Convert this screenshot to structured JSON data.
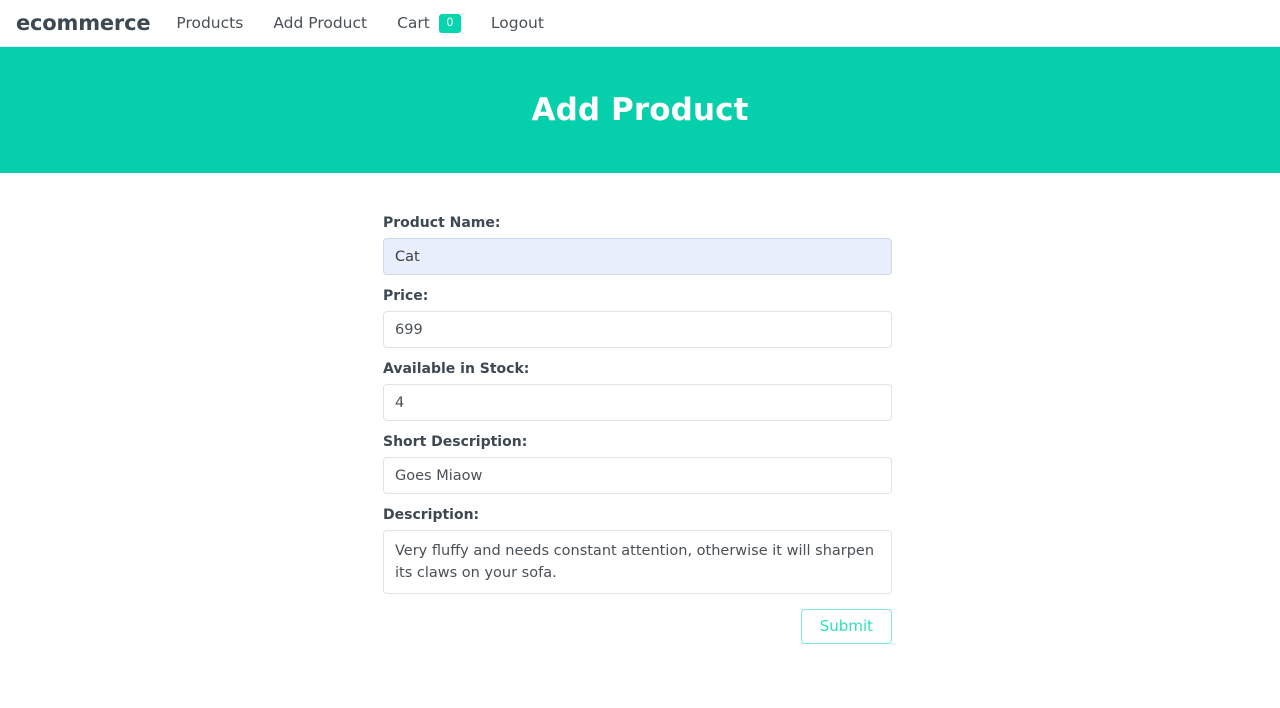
{
  "theme": {
    "accent": "#06d6ad",
    "hero_bg": "#06d0ab",
    "text_dark": "#3d4852",
    "autofill_bg": "#e8eefc",
    "submit_border": "#7ee8d6",
    "submit_text": "#2ee0bd"
  },
  "navbar": {
    "brand": "ecommerce",
    "links": [
      {
        "label": "Products",
        "name": "nav-link-products"
      },
      {
        "label": "Add Product",
        "name": "nav-link-add-product"
      },
      {
        "label": "Cart",
        "name": "nav-link-cart",
        "badge": "0"
      },
      {
        "label": "Logout",
        "name": "nav-link-logout"
      }
    ]
  },
  "hero": {
    "title": "Add Product"
  },
  "form": {
    "fields": [
      {
        "label": "Product Name:",
        "value": "Cat",
        "placeholder": "",
        "type": "text",
        "autofilled": true
      },
      {
        "label": "Price:",
        "value": "699",
        "placeholder": "",
        "type": "text",
        "autofilled": false
      },
      {
        "label": "Available in Stock:",
        "value": "4",
        "placeholder": "",
        "type": "text",
        "autofilled": false
      },
      {
        "label": "Short Description:",
        "value": "Goes Miaow",
        "placeholder": "",
        "type": "text",
        "autofilled": false
      },
      {
        "label": "Description:",
        "value": "Very fluffy and needs constant attention, otherwise it will sharpen its claws on your sofa.",
        "placeholder": "",
        "type": "textarea",
        "autofilled": false
      }
    ],
    "submit_label": "Submit"
  }
}
